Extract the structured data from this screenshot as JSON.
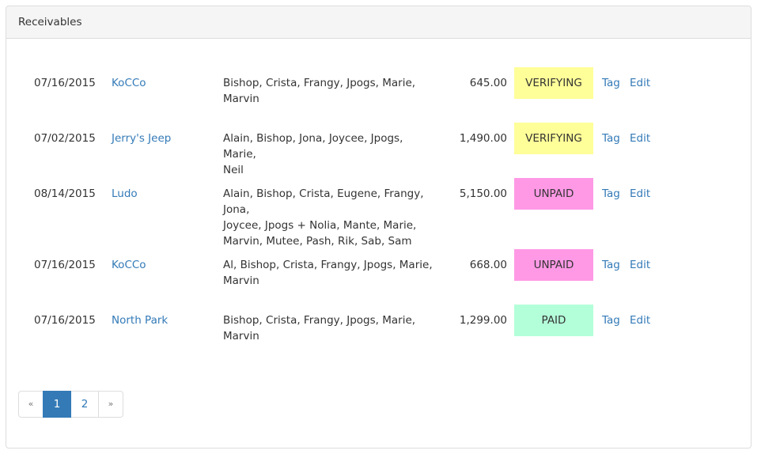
{
  "panel": {
    "title": "Receivables"
  },
  "colors": {
    "verifying": "#ffff99",
    "unpaid": "#ff99e6",
    "paid": "#b3ffd9",
    "link": "#337ab7"
  },
  "rows": [
    {
      "date": "07/16/2015",
      "client": "KoCCo",
      "people_line1": "Bishop, Crista, Frangy, Jpogs, Marie,",
      "people_line2": "Marvin",
      "people_line3": "",
      "amount": "645.00",
      "status": "VERIFYING",
      "tag": "Tag",
      "edit": "Edit"
    },
    {
      "date": "07/02/2015",
      "client": "Jerry's Jeep",
      "people_line1": "Alain, Bishop, Jona, Joycee, Jpogs, Marie,",
      "people_line2": "Neil",
      "people_line3": "",
      "amount": "1,490.00",
      "status": "VERIFYING",
      "tag": "Tag",
      "edit": "Edit"
    },
    {
      "date": "08/14/2015",
      "client": "Ludo",
      "people_line1": "Alain, Bishop, Crista, Eugene, Frangy, Jona,",
      "people_line2": "Joycee, Jpogs + Nolia, Mante, Marie,",
      "people_line3": "Marvin, Mutee, Pash, Rik, Sab, Sam",
      "amount": "5,150.00",
      "status": "UNPAID",
      "tag": "Tag",
      "edit": "Edit"
    },
    {
      "date": "07/16/2015",
      "client": "KoCCo",
      "people_line1": "Al, Bishop, Crista, Frangy, Jpogs, Marie,",
      "people_line2": "Marvin",
      "people_line3": "",
      "amount": "668.00",
      "status": "UNPAID",
      "tag": "Tag",
      "edit": "Edit"
    },
    {
      "date": "07/16/2015",
      "client": "North Park",
      "people_line1": "Bishop, Crista, Frangy, Jpogs, Marie,",
      "people_line2": "Marvin",
      "people_line3": "",
      "amount": "1,299.00",
      "status": "PAID",
      "tag": "Tag",
      "edit": "Edit"
    }
  ],
  "pagination": {
    "prev": "«",
    "pages": [
      "1",
      "2"
    ],
    "active_page": "1",
    "next": "»"
  }
}
